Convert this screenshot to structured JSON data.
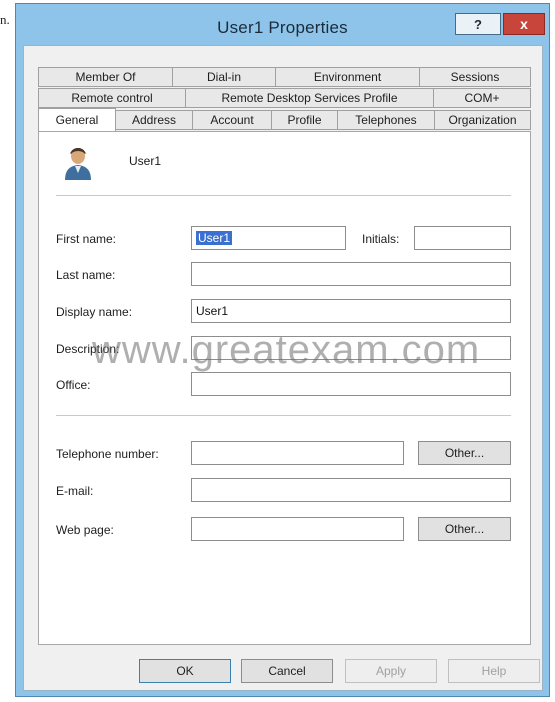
{
  "page": {
    "edge_text": "n."
  },
  "window": {
    "title": "User1 Properties",
    "help_label": "?",
    "close_label": "x"
  },
  "tabs": {
    "row1": [
      "Member Of",
      "Dial-in",
      "Environment",
      "Sessions"
    ],
    "row2": [
      "Remote control",
      "Remote Desktop Services Profile",
      "COM+"
    ],
    "row3": [
      "General",
      "Address",
      "Account",
      "Profile",
      "Telephones",
      "Organization"
    ],
    "active": "General"
  },
  "general": {
    "user_name": "User1",
    "first_name_label": "First name:",
    "first_name_value": "User1",
    "initials_label": "Initials:",
    "initials_value": "",
    "last_name_label": "Last name:",
    "last_name_value": "",
    "display_name_label": "Display name:",
    "display_name_value": "User1",
    "description_label": "Description:",
    "description_value": "",
    "office_label": "Office:",
    "office_value": "",
    "telephone_label": "Telephone number:",
    "telephone_value": "",
    "other_label": "Other...",
    "email_label": "E-mail:",
    "email_value": "",
    "webpage_label": "Web page:",
    "webpage_value": ""
  },
  "buttons": {
    "ok": "OK",
    "cancel": "Cancel",
    "apply": "Apply",
    "help": "Help"
  },
  "watermark": "www.greatexam.com",
  "icons": {
    "help": "help-icon",
    "close": "close-icon",
    "user": "user-icon"
  },
  "colors": {
    "title_bar": "#8ec4e9",
    "close_button": "#c8453b",
    "selection": "#3b6fd0"
  }
}
